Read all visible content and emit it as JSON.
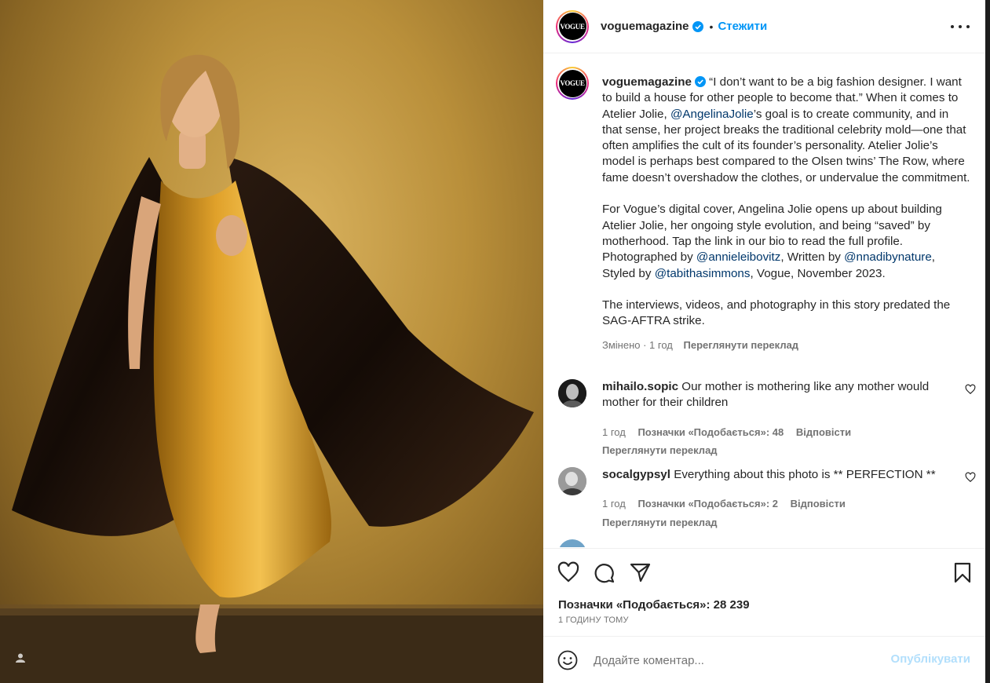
{
  "post": {
    "username": "voguemagazine",
    "avatar_text": "VOGUE",
    "follow_label": "Стежити",
    "dot": "•",
    "caption_paragraphs": [
      [
        {
          "t": "“I don’t want to be a big fashion designer. I want to build a house for other people to become that.” When it comes to Atelier Jolie, "
        },
        {
          "t": "@AngelinaJolie",
          "m": true
        },
        {
          "t": "’s goal is to create community, and in that sense, her project breaks the traditional celebrity mold—one that often amplifies the cult of its founder’s personality. Atelier Jolie’s model is perhaps best compared to the Olsen twins’ The Row, where fame doesn’t overshadow the clothes, or undervalue the commitment."
        }
      ],
      [
        {
          "t": "For Vogue’s digital cover, Angelina Jolie opens up about building Atelier Jolie, her ongoing style evolution, and being “saved” by motherhood. Tap the link in our bio to read the full profile. Photographed by "
        },
        {
          "t": "@annieleibovitz",
          "m": true
        },
        {
          "t": ", Written by "
        },
        {
          "t": "@nnadibynature",
          "m": true
        },
        {
          "t": ", Styled by "
        },
        {
          "t": "@tabithasimmons",
          "m": true
        },
        {
          "t": ", Vogue, November 2023."
        }
      ],
      [
        {
          "t": "The interviews, videos, and photography in this story predated the SAG-AFTRA strike."
        }
      ]
    ],
    "caption_meta": "Змінено · 1 год",
    "see_translation": "Переглянути переклад",
    "likes_label": "Позначки «Подобається»: 28 239",
    "timestamp": "1 ГОДИНУ ТОМУ"
  },
  "comments": [
    {
      "username": "mihailo.sopic",
      "text": "Our mother is mothering like any mother would mother for their children",
      "time": "1 год",
      "likes": "Позначки «Подобається»: 48",
      "reply": "Відповісти",
      "see_translation": "Переглянути переклад",
      "avatar_color": "#2b2b2b"
    },
    {
      "username": "socalgypsyl",
      "text": "Everything about this photo is ** PERFECTION **",
      "time": "1 год",
      "likes": "Позначки «Подобається»: 2",
      "reply": "Відповісти",
      "see_translation": "Переглянути переклад",
      "avatar_color": "#8a8a8a"
    }
  ],
  "comment_box": {
    "placeholder": "Додайте коментар...",
    "publish_label": "Опублікувати"
  },
  "colors": {
    "link": "#0095f6",
    "mention": "#00376b",
    "publish_disabled": "#b2dffc",
    "secondary_text": "#737373"
  },
  "icons": [
    "verified-badge-icon",
    "more-options-icon",
    "heart-icon",
    "comment-icon",
    "share-icon",
    "bookmark-icon",
    "emoji-icon",
    "user-tag-icon"
  ]
}
